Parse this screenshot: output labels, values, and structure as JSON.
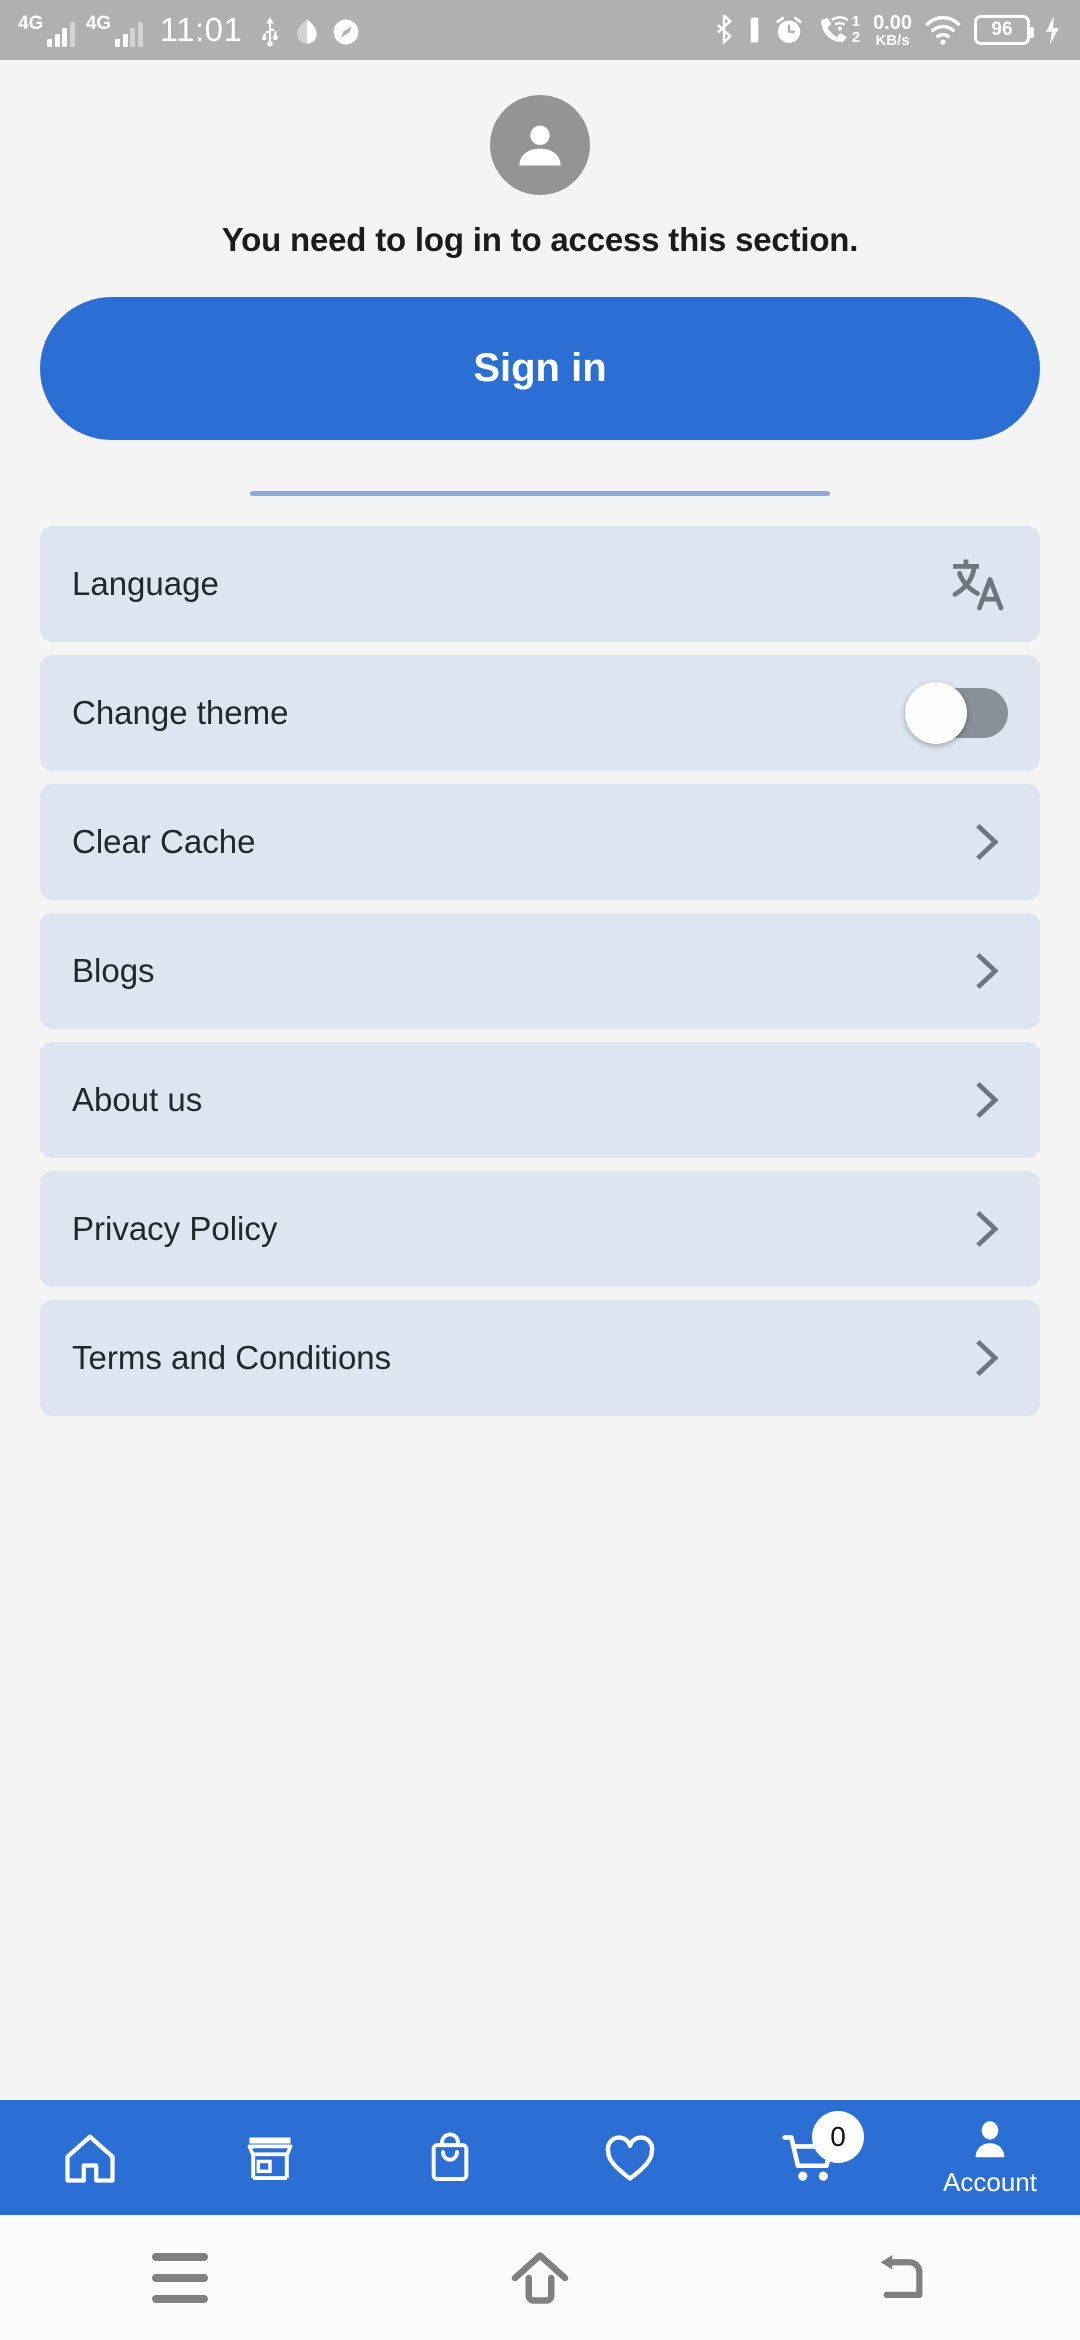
{
  "statusbar": {
    "network_1": "4G",
    "network_2": "4G",
    "time": "11:01",
    "icons_left": [
      "signal-4g-icon",
      "signal-4g-icon",
      "usb-icon",
      "data-saver-icon",
      "speedometer-icon"
    ],
    "net_speed_value": "0.00",
    "net_speed_unit": "KB/s",
    "sim_1": "1",
    "sim_2": "2",
    "battery_level": "96",
    "icons_right": [
      "bluetooth-icon",
      "vibrate-icon",
      "alarm-icon",
      "wifi-calling-icon",
      "network-speed-icon",
      "wifi-icon",
      "battery-icon",
      "charging-bolt-icon"
    ]
  },
  "account": {
    "avatar_icon": "person-icon",
    "login_message": "You need to log in to access this section.",
    "signin_label": "Sign in"
  },
  "settings": {
    "rows": [
      {
        "label": "Language",
        "control": "translate-icon"
      },
      {
        "label": "Change theme",
        "control": "toggle",
        "toggle_on": false
      },
      {
        "label": "Clear Cache",
        "control": "chevron"
      },
      {
        "label": "Blogs",
        "control": "chevron"
      },
      {
        "label": "About us",
        "control": "chevron"
      },
      {
        "label": "Privacy Policy",
        "control": "chevron"
      },
      {
        "label": "Terms and Conditions",
        "control": "chevron"
      }
    ]
  },
  "bottomnav": {
    "items": [
      {
        "icon": "home-icon",
        "label": ""
      },
      {
        "icon": "store-icon",
        "label": ""
      },
      {
        "icon": "shopping-bag-icon",
        "label": ""
      },
      {
        "icon": "heart-icon",
        "label": ""
      },
      {
        "icon": "cart-icon",
        "label": "",
        "badge": "0"
      },
      {
        "icon": "account-icon",
        "label": "Account"
      }
    ]
  },
  "androidnav": {
    "buttons": [
      "recents-icon",
      "home-icon",
      "back-icon"
    ]
  },
  "colors": {
    "accent": "#2b6fd4",
    "card": "#dee4f0",
    "page_bg": "#f4f4f4",
    "statusbar_bg": "#b0b0b0",
    "divider": "#8fabd8",
    "icon_gray": "#6f757e"
  }
}
